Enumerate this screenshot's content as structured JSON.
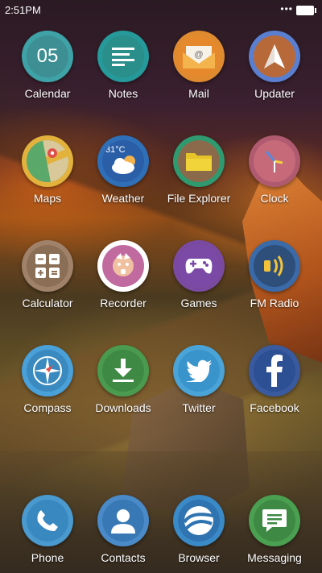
{
  "status_bar": {
    "time": "2:51PM",
    "signal": "•••"
  },
  "apps": [
    {
      "label": "Calendar",
      "icon": "calendar-icon",
      "ring": "#3ea2a6",
      "inner": "#3d8f93",
      "text": "05"
    },
    {
      "label": "Notes",
      "icon": "notes-icon",
      "ring": "#26999a",
      "inner": "#2a8e8a"
    },
    {
      "label": "Mail",
      "icon": "mail-icon",
      "ring": "#e08a30",
      "inner": "#e5892c",
      "text": "@"
    },
    {
      "label": "Updater",
      "icon": "updater-icon",
      "ring": "#5b7fd0",
      "inner": "#b8693a"
    },
    {
      "label": "Maps",
      "icon": "maps-icon",
      "ring": "#e3b23c",
      "inner": "#4e9a5a"
    },
    {
      "label": "Weather",
      "icon": "weather-icon",
      "ring": "#2f6fb8",
      "inner": "#2a5ea6",
      "text": "31°C"
    },
    {
      "label": "File Explorer",
      "icon": "folder-icon",
      "ring": "#2f9a70",
      "inner": "#8a6a4a"
    },
    {
      "label": "Clock",
      "icon": "clock-icon",
      "ring": "#b05a70",
      "inner": "#c66a7a"
    },
    {
      "label": "Calculator",
      "icon": "calculator-icon",
      "ring": "#a0826a",
      "inner": "#8a6e55"
    },
    {
      "label": "Recorder",
      "icon": "recorder-icon",
      "ring": "#ffffff",
      "inner": "#c06aa0"
    },
    {
      "label": "Games",
      "icon": "gamepad-icon",
      "ring": "#7a4aa0",
      "inner": "#7a4aa6"
    },
    {
      "label": "FM Radio",
      "icon": "radio-icon",
      "ring": "#3a6aa8",
      "inner": "#2e4f7a"
    },
    {
      "label": "Compass",
      "icon": "compass-icon",
      "ring": "#4aa0d8",
      "inner": "#3a8ac0"
    },
    {
      "label": "Downloads",
      "icon": "download-icon",
      "ring": "#4a9a50",
      "inner": "#3e8a44"
    },
    {
      "label": "Twitter",
      "icon": "twitter-icon",
      "ring": "#4aa4d8",
      "inner": "#3a94cc"
    },
    {
      "label": "Facebook",
      "icon": "facebook-icon",
      "ring": "#3a5aa0",
      "inner": "#2d4f94"
    }
  ],
  "dock": [
    {
      "label": "Phone",
      "icon": "phone-icon",
      "ring": "#4a9ad0",
      "inner": "#3a88c0"
    },
    {
      "label": "Contacts",
      "icon": "contacts-icon",
      "ring": "#4a8ac8",
      "inner": "#3878b4"
    },
    {
      "label": "Browser",
      "icon": "browser-icon",
      "ring": "#3a8ac8",
      "inner": "#2f74b0"
    },
    {
      "label": "Messaging",
      "icon": "messaging-icon",
      "ring": "#4aa050",
      "inner": "#3e8a44"
    }
  ]
}
